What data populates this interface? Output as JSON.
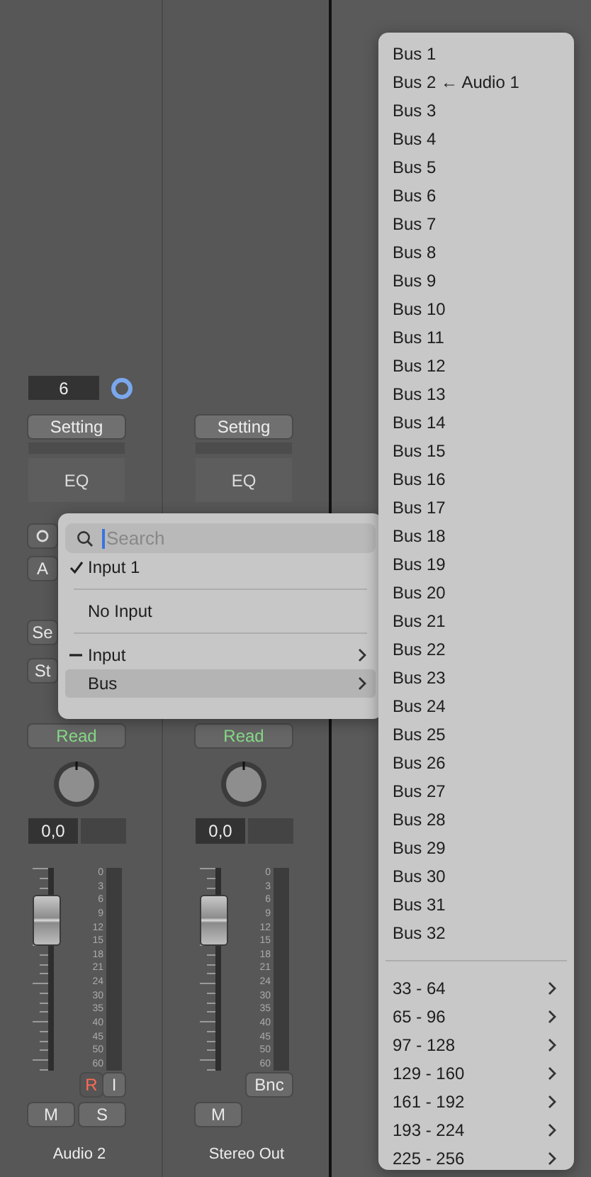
{
  "strips": [
    {
      "name": "Audio 2",
      "input_value": "6",
      "setting": "Setting",
      "eq": "EQ",
      "hidden_buttons": [
        {
          "kind": "circle"
        },
        {
          "kind": "text",
          "label": "A"
        },
        {
          "kind": "text",
          "label": "Se"
        },
        {
          "kind": "text",
          "label": "St"
        }
      ],
      "automation": "Read",
      "pan_value": "0,0",
      "fader": {
        "level": 0.74
      },
      "scale": [
        "0",
        "3",
        "6",
        "9",
        "12",
        "15",
        "18",
        "21",
        "24",
        "30",
        "35",
        "40",
        "45",
        "50",
        "60"
      ],
      "top_buttons": [
        {
          "label": "R",
          "kind": "record"
        },
        {
          "label": "I",
          "kind": "plain"
        }
      ],
      "bottom_buttons": [
        "M",
        "S"
      ]
    },
    {
      "name": "Stereo Out",
      "setting": "Setting",
      "eq": "EQ",
      "automation": "Read",
      "pan_value": "0,0",
      "fader": {
        "level": 0.74
      },
      "scale": [
        "0",
        "3",
        "6",
        "9",
        "12",
        "15",
        "18",
        "21",
        "24",
        "30",
        "35",
        "40",
        "45",
        "50",
        "60"
      ],
      "top_buttons": [
        {
          "label": "Bnc",
          "kind": "plain"
        }
      ],
      "bottom_buttons": [
        "M"
      ]
    }
  ],
  "input_menu": {
    "search": {
      "placeholder": "Search"
    },
    "groups": [
      [
        {
          "label": "Input 1",
          "checked": true,
          "mixed": false,
          "submenu": false,
          "selected": false
        }
      ],
      [
        {
          "label": "No Input",
          "checked": false,
          "mixed": false,
          "submenu": false,
          "selected": false
        }
      ],
      [
        {
          "label": "Input",
          "checked": false,
          "mixed": true,
          "submenu": true,
          "selected": false
        },
        {
          "label": "Bus",
          "checked": false,
          "mixed": false,
          "submenu": true,
          "selected": true
        }
      ]
    ]
  },
  "bus_menu": {
    "groups": [
      [
        {
          "label": "Bus 1",
          "submenu": false
        },
        {
          "label": "Bus 2 ← Audio 1",
          "submenu": false
        },
        {
          "label": "Bus 3",
          "submenu": false
        },
        {
          "label": "Bus 4",
          "submenu": false
        },
        {
          "label": "Bus 5",
          "submenu": false
        },
        {
          "label": "Bus 6",
          "submenu": false
        },
        {
          "label": "Bus 7",
          "submenu": false
        },
        {
          "label": "Bus 8",
          "submenu": false
        },
        {
          "label": "Bus 9",
          "submenu": false
        },
        {
          "label": "Bus 10",
          "submenu": false
        },
        {
          "label": "Bus 11",
          "submenu": false
        },
        {
          "label": "Bus 12",
          "submenu": false
        },
        {
          "label": "Bus 13",
          "submenu": false
        },
        {
          "label": "Bus 14",
          "submenu": false
        },
        {
          "label": "Bus 15",
          "submenu": false
        },
        {
          "label": "Bus 16",
          "submenu": false
        },
        {
          "label": "Bus 17",
          "submenu": false
        },
        {
          "label": "Bus 18",
          "submenu": false
        },
        {
          "label": "Bus 19",
          "submenu": false
        },
        {
          "label": "Bus 20",
          "submenu": false
        },
        {
          "label": "Bus 21",
          "submenu": false
        },
        {
          "label": "Bus 22",
          "submenu": false
        },
        {
          "label": "Bus 23",
          "submenu": false
        },
        {
          "label": "Bus 24",
          "submenu": false
        },
        {
          "label": "Bus 25",
          "submenu": false
        },
        {
          "label": "Bus 26",
          "submenu": false
        },
        {
          "label": "Bus 27",
          "submenu": false
        },
        {
          "label": "Bus 28",
          "submenu": false
        },
        {
          "label": "Bus 29",
          "submenu": false
        },
        {
          "label": "Bus 30",
          "submenu": false
        },
        {
          "label": "Bus 31",
          "submenu": false
        },
        {
          "label": "Bus 32",
          "submenu": false
        }
      ],
      [
        {
          "label": "33 - 64",
          "submenu": true
        },
        {
          "label": "65 - 96",
          "submenu": true
        },
        {
          "label": "97 - 128",
          "submenu": true
        },
        {
          "label": "129 - 160",
          "submenu": true
        },
        {
          "label": "161 - 192",
          "submenu": true
        },
        {
          "label": "193 - 224",
          "submenu": true
        },
        {
          "label": "225 - 256",
          "submenu": true
        }
      ]
    ]
  }
}
